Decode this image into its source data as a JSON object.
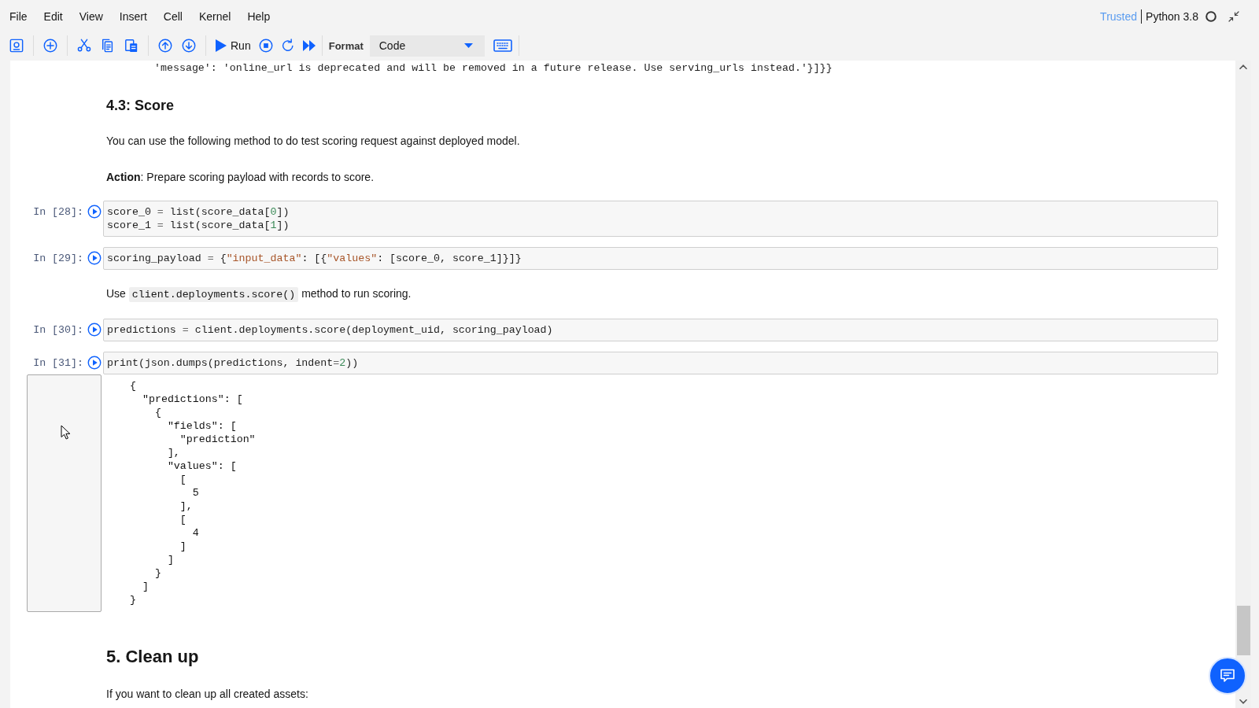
{
  "menu_bar": {
    "items": [
      "File",
      "Edit",
      "View",
      "Insert",
      "Cell",
      "Kernel",
      "Help"
    ]
  },
  "kernel": {
    "trusted_label": "Trusted",
    "name": "Python 3.8",
    "busy": false
  },
  "toolbar": {
    "run_label": "Run",
    "format_label": "Format",
    "cell_type": "Code"
  },
  "notebook": {
    "cells": [
      {
        "kind": "output_tail",
        "text": "'message': 'online_url is deprecated and will be removed in a future release. Use serving_urls instead.'}]}}"
      },
      {
        "kind": "subheading",
        "text": "4.3: Score"
      },
      {
        "kind": "paragraph",
        "parts": [
          {
            "kind": "text",
            "text": "You can use the following method to do test scoring request against deployed model."
          }
        ]
      },
      {
        "kind": "paragraph",
        "parts": [
          {
            "kind": "text",
            "text": "**Action**: Prepare scoring payload with records to score."
          }
        ]
      },
      {
        "kind": "code",
        "prompt": "In [28]:",
        "lines": [
          {
            "tokens": [
              {
                "kind": "plain",
                "text": "score_0 "
              },
              {
                "kind": "op",
                "text": "="
              },
              {
                "kind": "plain",
                "text": " list(score_data["
              },
              {
                "kind": "number",
                "text": "0"
              },
              {
                "kind": "plain",
                "text": "])"
              }
            ]
          },
          {
            "tokens": [
              {
                "kind": "plain",
                "text": "score_1 "
              },
              {
                "kind": "op",
                "text": "="
              },
              {
                "kind": "plain",
                "text": " list(score_data["
              },
              {
                "kind": "number",
                "text": "1"
              },
              {
                "kind": "plain",
                "text": "])"
              }
            ]
          }
        ]
      },
      {
        "kind": "code",
        "prompt": "In [29]:",
        "lines": [
          {
            "tokens": [
              {
                "kind": "plain",
                "text": "scoring_payload "
              },
              {
                "kind": "op",
                "text": "="
              },
              {
                "kind": "plain",
                "text": " {"
              },
              {
                "kind": "string",
                "text": "\"input_data\""
              },
              {
                "kind": "plain",
                "text": ": [{"
              },
              {
                "kind": "string",
                "text": "\"values\""
              },
              {
                "kind": "plain",
                "text": ": [score_0, score_1]}]}"
              }
            ]
          }
        ]
      },
      {
        "kind": "paragraph",
        "parts": [
          {
            "kind": "text",
            "text": "Use "
          },
          {
            "kind": "code",
            "text": "client.deployments.score()"
          },
          {
            "kind": "text",
            "text": " method to run scoring."
          }
        ]
      },
      {
        "kind": "code",
        "prompt": "In [30]:",
        "lines": [
          {
            "tokens": [
              {
                "kind": "plain",
                "text": "predictions "
              },
              {
                "kind": "op",
                "text": "="
              },
              {
                "kind": "plain",
                "text": " client.deployments.score(deployment_uid, scoring_payload)"
              }
            ]
          }
        ]
      },
      {
        "kind": "code",
        "prompt": "In [31]:",
        "lines": [
          {
            "tokens": [
              {
                "kind": "plain",
                "text": "print(json.dumps(predictions, indent"
              },
              {
                "kind": "op",
                "text": "="
              },
              {
                "kind": "number",
                "text": "2"
              },
              {
                "kind": "plain",
                "text": "))"
              }
            ]
          }
        ],
        "output": {
          "lines": [
            "{",
            "  \"predictions\": [",
            "    {",
            "      \"fields\": [",
            "        \"prediction\"",
            "      ],",
            "      \"values\": [",
            "        [",
            "          5",
            "        ],",
            "        [",
            "          4",
            "        ]",
            "      ]",
            "    }",
            "  ]",
            "}"
          ]
        }
      },
      {
        "kind": "heading",
        "text": "5. Clean up"
      },
      {
        "kind": "paragraph",
        "parts": [
          {
            "kind": "text",
            "text": "If you want to clean up all created assets:"
          }
        ]
      }
    ]
  }
}
